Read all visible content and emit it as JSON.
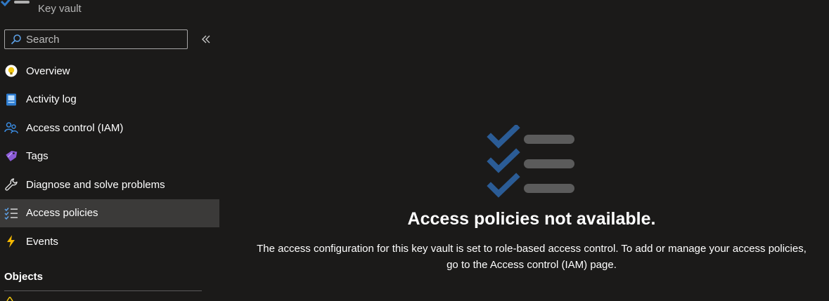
{
  "header": {
    "subtitle": "Key vault"
  },
  "sidebar": {
    "search_placeholder": "Search",
    "items": [
      {
        "label": "Overview",
        "icon": "overview-icon"
      },
      {
        "label": "Activity log",
        "icon": "activity-log-icon"
      },
      {
        "label": "Access control (IAM)",
        "icon": "people-icon"
      },
      {
        "label": "Tags",
        "icon": "tag-icon"
      },
      {
        "label": "Diagnose and solve problems",
        "icon": "wrench-icon"
      },
      {
        "label": "Access policies",
        "icon": "checklist-icon",
        "active": true
      },
      {
        "label": "Events",
        "icon": "lightning-icon"
      }
    ],
    "section_objects": "Objects"
  },
  "main": {
    "title": "Access policies not available.",
    "message_line1": "The access configuration for this key vault is set to role-based access control. To add or manage your access policies,",
    "message_line2": "go to the Access control (IAM) page."
  },
  "colors": {
    "background": "#1b1a19",
    "active_item": "#3b3a39",
    "check_blue": "#2b5c96",
    "bar_gray": "#5b5b5b"
  }
}
